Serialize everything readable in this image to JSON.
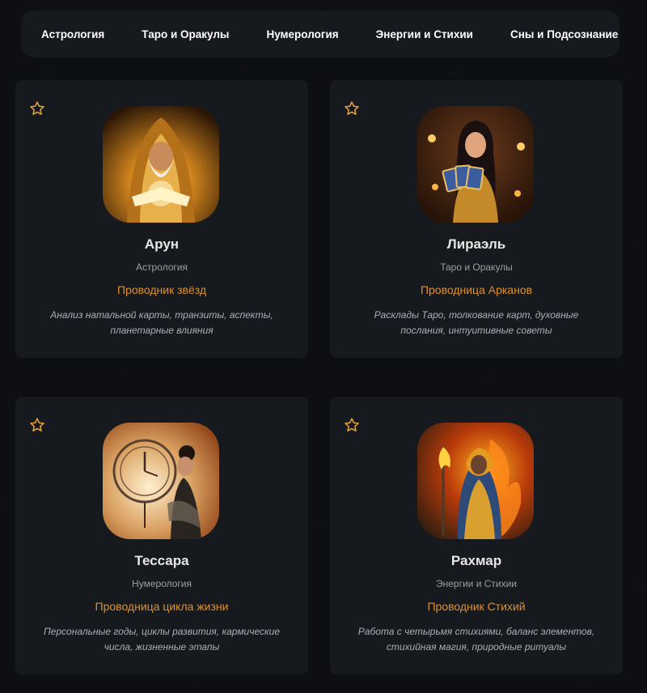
{
  "nav": {
    "tabs": [
      "Астрология",
      "Таро и Оракулы",
      "Нумерология",
      "Энергии и Стихии",
      "Сны и Подсознание"
    ]
  },
  "cards": [
    {
      "name": "Арун",
      "category": "Астрология",
      "role": "Проводник звёзд",
      "description": "Анализ натальной карты, транзиты, аспекты, планетарные влияния",
      "avatar_icon": "wizard-with-glowing-book"
    },
    {
      "name": "Лираэль",
      "category": "Таро и Оракулы",
      "role": "Проводница Арканов",
      "description": "Расклады Таро, толкование карт, духовные послания, интуитивные советы",
      "avatar_icon": "woman-holding-tarot-cards"
    },
    {
      "name": "Тессара",
      "category": "Нумерология",
      "role": "Проводница цикла жизни",
      "description": "Персональные годы, циклы развития, кармические числа, жизненные этапы",
      "avatar_icon": "woman-with-clock"
    },
    {
      "name": "Рахмар",
      "category": "Энергии и Стихии",
      "role": "Проводник Стихий",
      "description": "Работа с четырьмя стихиями, баланс элементов, стихийная магия, природные ритуалы",
      "avatar_icon": "fire-mage-with-staff"
    }
  ],
  "colors": {
    "background": "#0d0f12",
    "card": "#16191d",
    "accent": "#e0912b",
    "star_outline": "#e8a33a"
  }
}
